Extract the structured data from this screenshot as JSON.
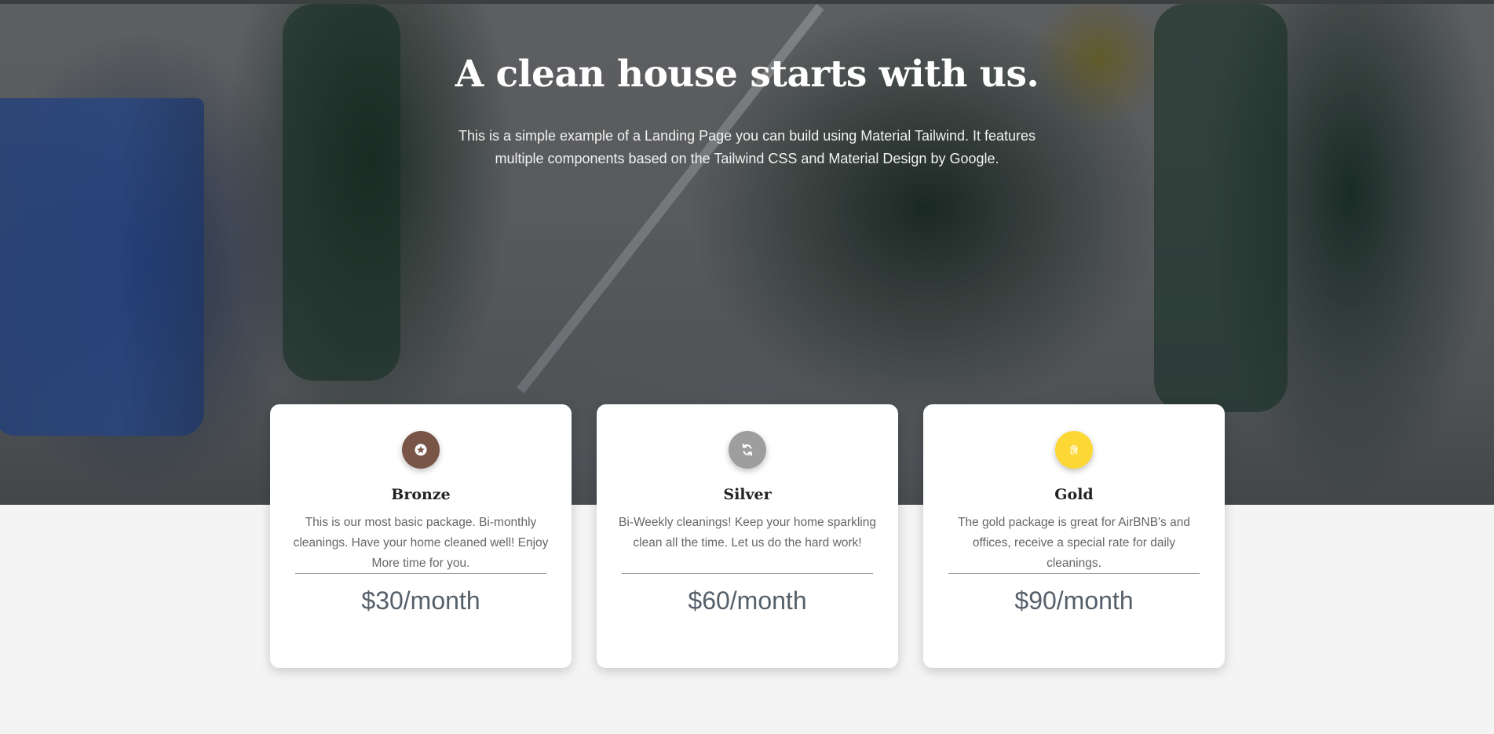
{
  "hero": {
    "title": "A clean house starts with us.",
    "subtitle": "This is a simple example of a Landing Page you can build using Material Tailwind. It features multiple components based on the Tailwind CSS and Material Design by Google."
  },
  "colors": {
    "bronze_icon": "#795548",
    "silver_icon": "#9e9e9e",
    "gold_icon": "#fdd835",
    "page_background": "#f4f4f4",
    "card_background": "#ffffff"
  },
  "packages": [
    {
      "title": "Bronze",
      "icon": "star-badge-icon",
      "description": "This is our most basic package. Bi-monthly cleanings. Have your home cleaned well! Enjoy More time for you.",
      "price": "$30/month"
    },
    {
      "title": "Silver",
      "icon": "refresh-icon",
      "description": "Bi-Weekly cleanings! Keep your home sparkling clean all the time. Let us do the hard work!",
      "price": "$60/month"
    },
    {
      "title": "Gold",
      "icon": "fingerprint-icon",
      "description": "The gold package is great for AirBNB's and offices, receive a special rate for daily cleanings.",
      "price": "$90/month"
    }
  ]
}
